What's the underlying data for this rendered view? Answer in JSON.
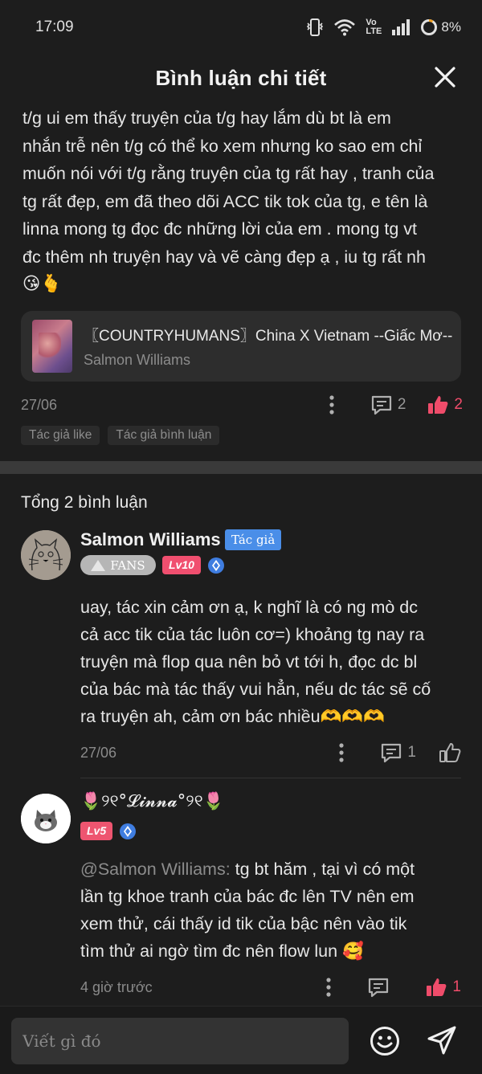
{
  "status_bar": {
    "time": "17:09",
    "network_label": "Vo LTE",
    "battery": "8%"
  },
  "header": {
    "title": "Bình luận chi tiết"
  },
  "main_comment": {
    "lines": [
      "t/g ui em thấy truyện của t/g hay lắm dù bt là em",
      "nhắn trễ nên t/g có thể ko xem nhưng ko sao em chỉ",
      "muốn nói với t/g rằng truyện của tg rất hay , tranh của",
      "tg rất đẹp, em đã theo dõi ACC tik tok của tg, e tên là",
      "linna mong tg đọc đc những lời của em . mong tg vt",
      "đc thêm nh truyện hay và vẽ càng đẹp ạ , iu tg rất nh"
    ],
    "emoji": "😘🫰",
    "story": {
      "title": "〖COUNTRYHUMANS〗China X Vietnam --Giấc Mơ--",
      "author": "Salmon Williams"
    },
    "date": "27/06",
    "reply_count": "2",
    "like_count": "2",
    "tags": [
      "Tác giả like",
      "Tác giả bình luận"
    ]
  },
  "total_label": "Tổng 2 bình luận",
  "reply1": {
    "name": "Salmon Williams",
    "author_badge": "Tác giả",
    "fans_badge": "FANS",
    "level": "Lv10",
    "text_lines": [
      "uay, tác xin cảm ơn ạ, k nghĩ là có ng mò dc",
      "cả acc tik của tác luôn cơ=) khoảng tg nay ra",
      "truyện mà flop qua nên bỏ vt tới h, đọc dc bl",
      "của bác mà tác thấy vui hẳn, nếu dc tác sẽ cố",
      "ra truyện ah, cảm ơn bác nhiều🫶🫶🫶"
    ],
    "date": "27/06",
    "reply_count": "1"
  },
  "reply2": {
    "name": "🌷୨୧°𝓛𝓲𝓷𝓷𝓪°୨୧🌷",
    "level": "Lv5",
    "mention": "@Salmon Williams:",
    "text_lines": [
      " tg bt hăm , tại vì có một",
      "lần tg khoe tranh của bác đc lên TV nên em",
      "xem thử, cái thấy id tik của bậc nên vào tik",
      "tìm thử ai ngờ tìm đc nên flow lun 🥰"
    ],
    "date": "4 giờ trước",
    "like_count": "1"
  },
  "input": {
    "placeholder": "Viết gì đó"
  },
  "colors": {
    "like_active": "#ef4c6a",
    "author_badge": "#4a8ee8",
    "level_badge": "#f04f6f",
    "background": "#1d1d1d"
  }
}
